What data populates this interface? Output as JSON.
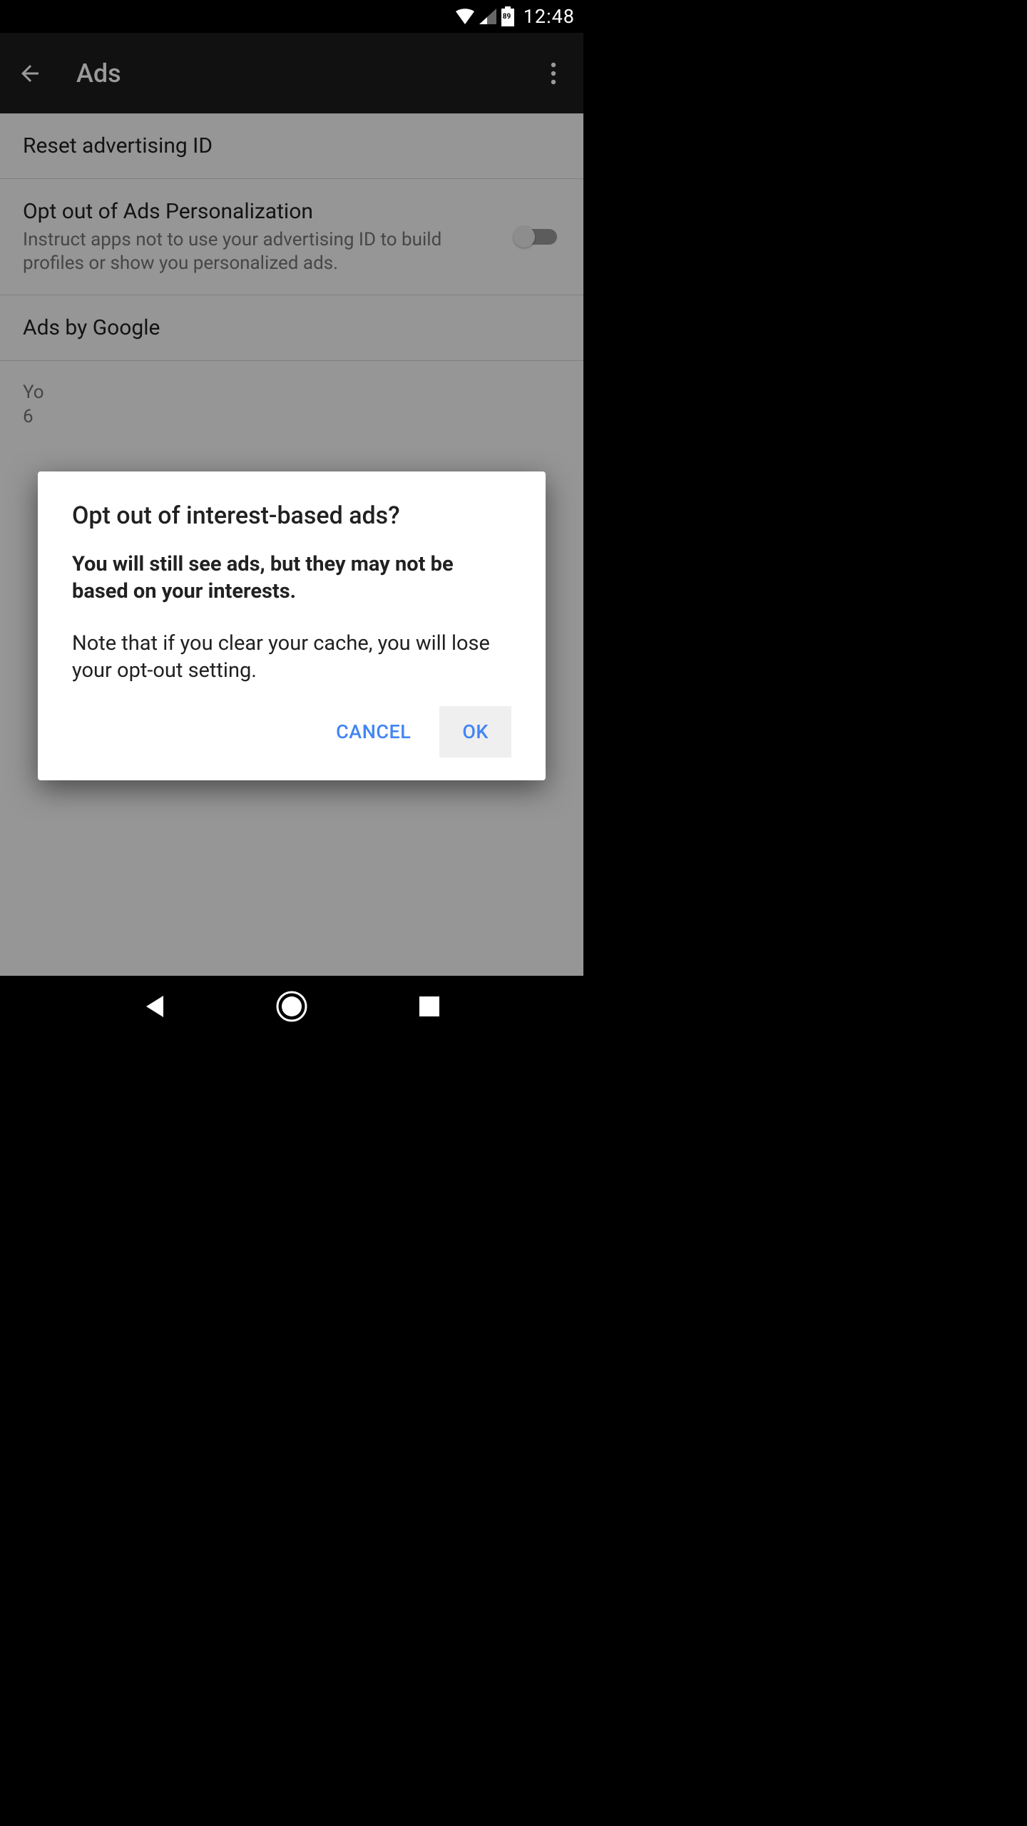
{
  "status_bar": {
    "battery_percent": "89",
    "time": "12:48"
  },
  "app_bar": {
    "title": "Ads"
  },
  "settings": {
    "reset_ad_id": {
      "label": "Reset advertising ID"
    },
    "opt_out": {
      "label": "Opt out of Ads Personalization",
      "description": "Instruct apps not to use your advertising ID to build profiles or show you personalized ads.",
      "toggle_on": false
    },
    "ads_by_google": {
      "label": "Ads by Google"
    },
    "ad_id": {
      "prefix": "Yo",
      "line2": "6"
    }
  },
  "dialog": {
    "title": "Opt out of interest-based ads?",
    "body_bold": "You will still see ads, but they may not be based on your interests.",
    "body": "Note that if you clear your cache, you will lose your opt-out setting.",
    "cancel_label": "CANCEL",
    "ok_label": "OK"
  }
}
